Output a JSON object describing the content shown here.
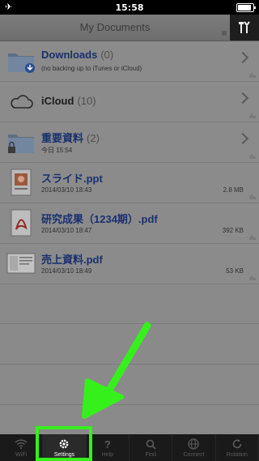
{
  "status_bar": {
    "time": "15:58"
  },
  "nav": {
    "title": "My Documents"
  },
  "rows": [
    {
      "name": "Downloads",
      "count": "(0)",
      "sub": "(no backing up to iTunes or iCloud)"
    },
    {
      "name": "iCloud",
      "count": "(10)"
    },
    {
      "name": "重要資料",
      "count": "(2)",
      "sub": "今日 15:54"
    },
    {
      "name": "スライド.ppt",
      "sub": "2014/03/10 18:43",
      "size": "2.8 MB"
    },
    {
      "name": "研究成果（1234期）.pdf",
      "sub": "2014/03/10 18:47",
      "size": "392 KB"
    },
    {
      "name": "売上資料.pdf",
      "sub": "2014/03/10 18:49",
      "size": "53 KB"
    }
  ],
  "tabs": [
    {
      "label": "WiFi",
      "icon": "wifi-icon"
    },
    {
      "label": "Settings",
      "icon": "gear-icon"
    },
    {
      "label": "Help",
      "icon": "help-icon"
    },
    {
      "label": "Find",
      "icon": "search-icon"
    },
    {
      "label": "Connect",
      "icon": "globe-icon"
    },
    {
      "label": "Rotation",
      "icon": "rotation-icon"
    }
  ],
  "colors": {
    "annotation": "#36f01c",
    "link": "#19306e"
  }
}
